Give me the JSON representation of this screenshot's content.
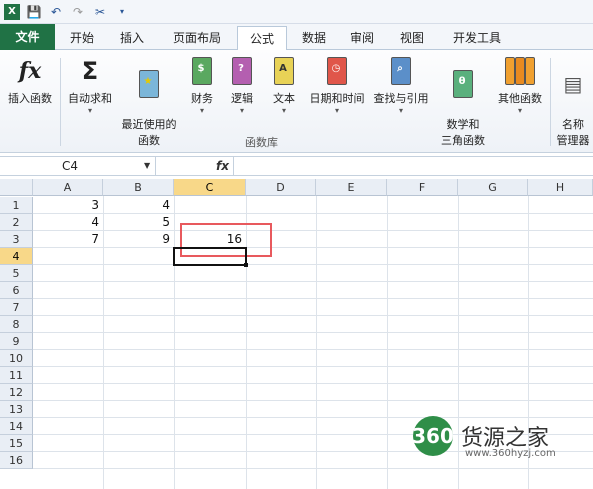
{
  "qat": {
    "save": "save-icon",
    "undo": "undo-icon",
    "redo": "redo-icon",
    "customize": "dropdown-icon"
  },
  "tabs": [
    "文件",
    "开始",
    "插入",
    "页面布局",
    "公式",
    "数据",
    "审阅",
    "视图",
    "开发工具"
  ],
  "ribbon": {
    "insert_function": "插入函数",
    "autosum": "自动求和",
    "recent": "最近使用的\n函数",
    "finance": "财务",
    "logic": "逻辑",
    "text": "文本",
    "datetime": "日期和时间",
    "lookup": "查找与引用",
    "math": "数学和\n三角函数",
    "more": "其他函数",
    "name_mgr": "名称\n管理器",
    "group_label": "函数库"
  },
  "formula_bar": {
    "namebox": "C4",
    "fx": "fx",
    "value": ""
  },
  "columns": [
    "A",
    "B",
    "C",
    "D",
    "E",
    "F",
    "G",
    "H"
  ],
  "rows": [
    "1",
    "2",
    "3",
    "4",
    "5",
    "6",
    "7",
    "8",
    "9",
    "10",
    "11",
    "12",
    "13",
    "14",
    "15",
    "16"
  ],
  "cells": {
    "A1": "3",
    "B1": "4",
    "A2": "4",
    "B2": "5",
    "A3": "7",
    "B3": "9",
    "C3": "16"
  },
  "watermark": {
    "logo": "360",
    "text": "货源之家",
    "url": "www.360hyzj.com"
  }
}
